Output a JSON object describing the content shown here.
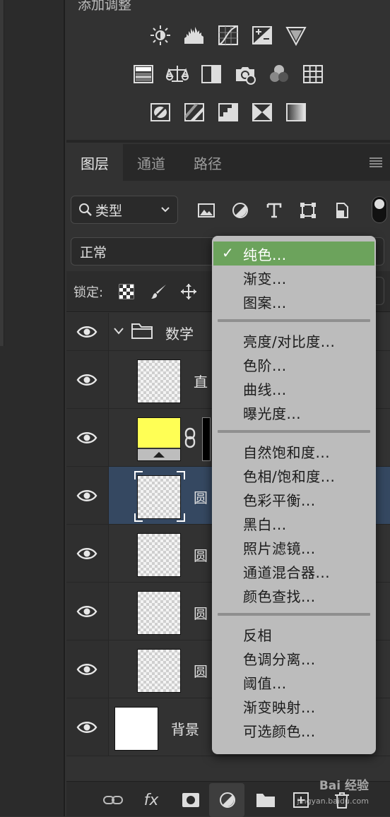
{
  "adjustments": {
    "title": "添加调整",
    "row1": [
      "brightness-icon",
      "levels-icon",
      "curves-icon",
      "exposure-icon",
      "vibrance-icon"
    ],
    "row2": [
      "hue-saturation-icon",
      "color-balance-icon",
      "black-white-icon",
      "photo-filter-icon",
      "channel-mixer-icon",
      "color-lookup-icon"
    ],
    "row3": [
      "invert-icon",
      "posterize-icon",
      "threshold-icon",
      "selective-color-icon",
      "gradient-map-icon"
    ]
  },
  "tabs": [
    {
      "label": "图层",
      "active": true
    },
    {
      "label": "通道",
      "active": false
    },
    {
      "label": "路径",
      "active": false
    }
  ],
  "filter": {
    "kind_label": "类型",
    "icons": [
      "image-filter-icon",
      "adjustment-filter-icon",
      "type-filter-icon",
      "shape-filter-icon",
      "smart-object-filter-icon"
    ]
  },
  "blend_mode": "正常",
  "lock": {
    "label": "锁定:"
  },
  "layers": [
    {
      "type": "group",
      "name": "数学",
      "visible": true
    },
    {
      "type": "layer",
      "name": "直",
      "thumb": "transparent",
      "visible": true,
      "selected": false
    },
    {
      "type": "fill",
      "name": "",
      "thumb": "yellow",
      "visible": true,
      "selected": false
    },
    {
      "type": "layer",
      "name": "圆",
      "thumb": "transparent",
      "visible": true,
      "selected": true
    },
    {
      "type": "layer",
      "name": "圆",
      "thumb": "transparent",
      "visible": true,
      "selected": false
    },
    {
      "type": "layer",
      "name": "圆",
      "thumb": "transparent",
      "visible": true,
      "selected": false
    },
    {
      "type": "layer",
      "name": "圆",
      "thumb": "transparent",
      "visible": true,
      "selected": false
    },
    {
      "type": "background",
      "name": "背景",
      "thumb": "white",
      "visible": true,
      "selected": false
    }
  ],
  "menu": {
    "checked_mark": "✓",
    "groups": [
      [
        "纯色...",
        "渐变...",
        "图案..."
      ],
      [
        "亮度/对比度...",
        "色阶...",
        "曲线...",
        "曝光度..."
      ],
      [
        "自然饱和度...",
        "色相/饱和度...",
        "色彩平衡...",
        "黑白...",
        "照片滤镜...",
        "通道混合器...",
        "颜色查找..."
      ],
      [
        "反相",
        "色调分离...",
        "阈值...",
        "渐变映射...",
        "可选颜色..."
      ]
    ]
  },
  "bottom_bar": {
    "fx_label": "fx",
    "icons": [
      "link-layers-icon",
      "fx-icon",
      "mask-icon",
      "new-adjustment-icon",
      "new-group-icon",
      "new-layer-icon",
      "delete-icon"
    ]
  },
  "watermark": {
    "text": "Bai 经验",
    "sub": "jingyan.baidu.com"
  },
  "colors": {
    "menu_highlight": "#6ca35c",
    "selected_layer": "#354861",
    "fill_swatch": "#ffff55"
  }
}
